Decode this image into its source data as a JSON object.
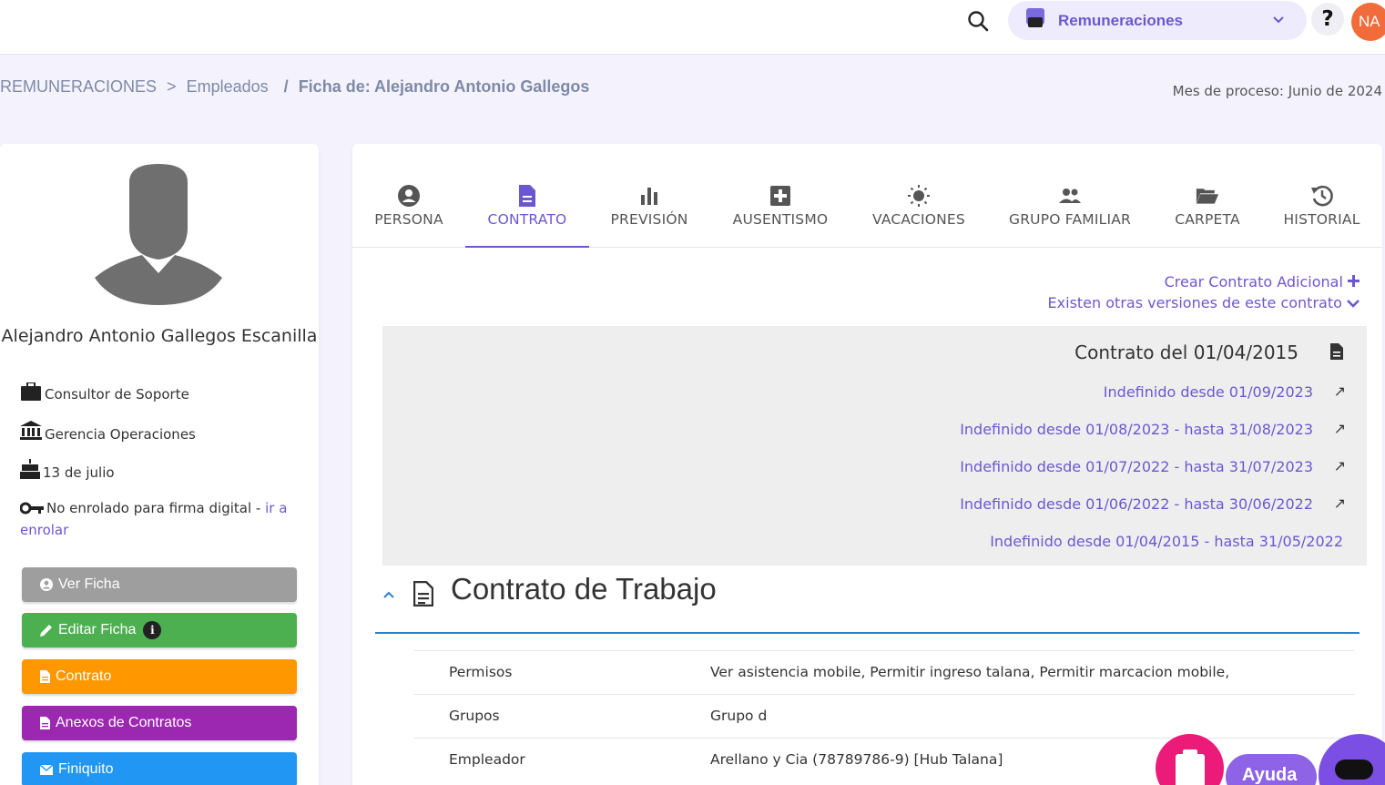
{
  "topbar": {
    "module_label": "Remuneraciones",
    "help_label": "?",
    "user_initials": "NA"
  },
  "breadcrumb": {
    "root": "REMUNERACIONES",
    "sep1": ">",
    "section": "Empleados",
    "sep2": "/",
    "current": "Ficha de: Alejandro Antonio Gallegos"
  },
  "process_month": "Mes de proceso: Junio de 2024",
  "employee": {
    "name": "Alejandro Antonio Gallegos Escanilla",
    "role": "Consultor de Soporte",
    "department": "Gerencia Operaciones",
    "birthday": "13 de julio",
    "signature_status": "No enrolado para firma digital -",
    "enroll_link": "ir a enrolar"
  },
  "side_buttons": {
    "view": "Ver Ficha",
    "edit": "Editar Ficha",
    "edit_info": "i",
    "contract": "Contrato",
    "annexes": "Anexos de Contratos",
    "settlement": "Finiquito"
  },
  "tabs": [
    {
      "label": "PERSONA",
      "icon": "person-circle-icon"
    },
    {
      "label": "CONTRATO",
      "icon": "document-icon"
    },
    {
      "label": "PREVISIÓN",
      "icon": "bar-chart-icon"
    },
    {
      "label": "AUSENTISMO",
      "icon": "medical-plus-icon"
    },
    {
      "label": "VACACIONES",
      "icon": "sun-icon"
    },
    {
      "label": "GRUPO FAMILIAR",
      "icon": "people-icon"
    },
    {
      "label": "CARPETA",
      "icon": "folder-open-icon"
    },
    {
      "label": "HISTORIAL",
      "icon": "history-icon"
    }
  ],
  "active_tab": "CONTRATO",
  "actions": {
    "create_additional": "Crear Contrato Adicional",
    "other_versions": "Existen otras versiones de este contrato"
  },
  "versions": {
    "title": "Contrato del 01/04/2015",
    "items": [
      "Indefinido desde 01/09/2023",
      "Indefinido desde 01/08/2023 - hasta 31/08/2023",
      "Indefinido desde 01/07/2022 - hasta 31/07/2023",
      "Indefinido desde 01/06/2022 - hasta 30/06/2022",
      "Indefinido desde 01/04/2015 - hasta 31/05/2022"
    ]
  },
  "section": {
    "title": "Contrato de Trabajo",
    "rows": [
      {
        "key": "Permisos",
        "value": "Ver asistencia mobile, Permitir ingreso talana, Permitir marcacion mobile,"
      },
      {
        "key": "Grupos",
        "value": "Grupo d"
      },
      {
        "key": "Empleador",
        "value": "Arellano y Cia (78789786-9) [Hub Talana]"
      }
    ]
  },
  "floating": {
    "help_label": "Ayuda"
  },
  "colors": {
    "accent": "#6b58d0",
    "section_line": "#2a7fd4",
    "btn_gray": "#9e9e9e",
    "btn_green": "#4caf50",
    "btn_orange": "#ff9800",
    "btn_purple": "#9c27b0",
    "btn_blue": "#2196f3"
  }
}
